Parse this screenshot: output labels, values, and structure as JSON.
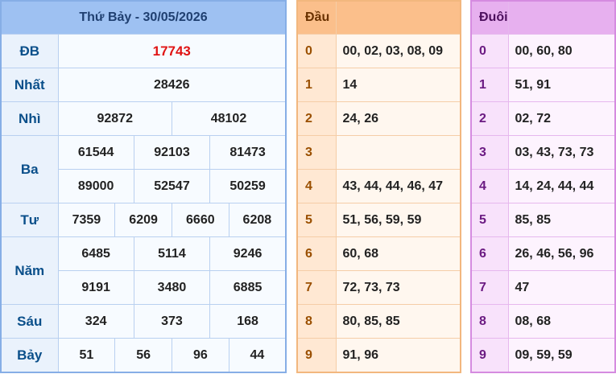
{
  "results": {
    "title": "Thứ Bảy - 30/05/2026",
    "prizes": {
      "db": {
        "label": "ĐB",
        "values": [
          "17743"
        ]
      },
      "nhat": {
        "label": "Nhất",
        "values": [
          "28426"
        ]
      },
      "nhi": {
        "label": "Nhì",
        "values": [
          "92872",
          "48102"
        ]
      },
      "ba": {
        "label": "Ba",
        "values": [
          "61544",
          "92103",
          "81473",
          "89000",
          "52547",
          "50259"
        ]
      },
      "tu": {
        "label": "Tư",
        "values": [
          "7359",
          "6209",
          "6660",
          "6208"
        ]
      },
      "nam": {
        "label": "Năm",
        "values": [
          "6485",
          "5114",
          "9246",
          "9191",
          "3480",
          "6885"
        ]
      },
      "sau": {
        "label": "Sáu",
        "values": [
          "324",
          "373",
          "168"
        ]
      },
      "bay": {
        "label": "Bảy",
        "values": [
          "51",
          "56",
          "96",
          "44"
        ]
      }
    }
  },
  "dau": {
    "title": "Đầu",
    "rows": [
      {
        "k": "0",
        "v": "00, 02, 03, 08, 09"
      },
      {
        "k": "1",
        "v": "14"
      },
      {
        "k": "2",
        "v": "24, 26"
      },
      {
        "k": "3",
        "v": ""
      },
      {
        "k": "4",
        "v": "43, 44, 44, 46, 47"
      },
      {
        "k": "5",
        "v": "51, 56, 59, 59"
      },
      {
        "k": "6",
        "v": "60, 68"
      },
      {
        "k": "7",
        "v": "72, 73, 73"
      },
      {
        "k": "8",
        "v": "80, 85, 85"
      },
      {
        "k": "9",
        "v": "91, 96"
      }
    ]
  },
  "duoi": {
    "title": "Đuôi",
    "rows": [
      {
        "k": "0",
        "v": "00, 60, 80"
      },
      {
        "k": "1",
        "v": "51, 91"
      },
      {
        "k": "2",
        "v": "02, 72"
      },
      {
        "k": "3",
        "v": "03, 43, 73, 73"
      },
      {
        "k": "4",
        "v": "14, 24, 44, 44"
      },
      {
        "k": "5",
        "v": "85, 85"
      },
      {
        "k": "6",
        "v": "26, 46, 56, 96"
      },
      {
        "k": "7",
        "v": "47"
      },
      {
        "k": "8",
        "v": "08, 68"
      },
      {
        "k": "9",
        "v": "09, 59, 59"
      }
    ]
  }
}
